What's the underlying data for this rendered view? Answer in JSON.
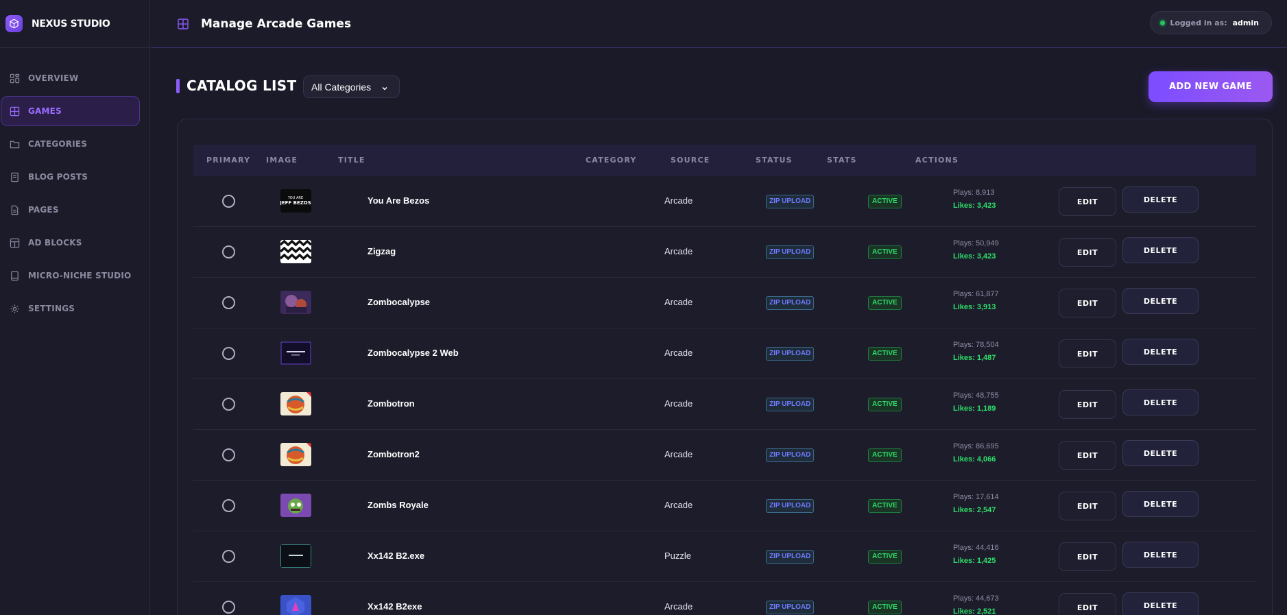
{
  "brand": {
    "name": "NEXUS STUDIO"
  },
  "sidebar": {
    "items": [
      {
        "label": "OVERVIEW",
        "icon": "dashboard-icon"
      },
      {
        "label": "GAMES",
        "icon": "grid-icon",
        "active": true
      },
      {
        "label": "CATEGORIES",
        "icon": "folder-icon"
      },
      {
        "label": "BLOG POSTS",
        "icon": "book-icon"
      },
      {
        "label": "PAGES",
        "icon": "document-icon"
      },
      {
        "label": "AD BLOCKS",
        "icon": "ad-grid-icon"
      },
      {
        "label": "MICRO-NICHE STUDIO",
        "icon": "notebook-icon"
      },
      {
        "label": "SETTINGS",
        "icon": "gear-icon"
      }
    ]
  },
  "header": {
    "title": "Manage Arcade Games",
    "login_label": "Logged in as:",
    "login_user": "admin"
  },
  "toolbar": {
    "catalog_title": "CATALOG LIST",
    "category_filter": "All Categories",
    "add_button": "ADD NEW GAME"
  },
  "table": {
    "headers": [
      "PRIMARY",
      "IMAGE",
      "TITLE",
      "CATEGORY",
      "SOURCE",
      "STATUS",
      "STATS",
      "ACTIONS"
    ],
    "edit_label": "EDIT",
    "delete_label": "DELETE",
    "rows": [
      {
        "title": "You Are Bezos",
        "category": "Arcade",
        "source": "ZIP UPLOAD",
        "status": "ACTIVE",
        "plays": "Plays: 8,913",
        "likes": "Likes: 3,423",
        "thumb": "bezos"
      },
      {
        "title": "Zigzag",
        "category": "Arcade",
        "source": "ZIP UPLOAD",
        "status": "ACTIVE",
        "plays": "Plays: 50,949",
        "likes": "Likes: 3,423",
        "thumb": "zigzag"
      },
      {
        "title": "Zombocalypse",
        "category": "Arcade",
        "source": "ZIP UPLOAD",
        "status": "ACTIVE",
        "plays": "Plays: 61,877",
        "likes": "Likes: 3,913",
        "thumb": "zombo"
      },
      {
        "title": "Zombocalypse 2 Web",
        "category": "Arcade",
        "source": "ZIP UPLOAD",
        "status": "ACTIVE",
        "plays": "Plays: 78,504",
        "likes": "Likes: 1,487",
        "thumb": "zombo2"
      },
      {
        "title": "Zombotron",
        "category": "Arcade",
        "source": "ZIP UPLOAD",
        "status": "ACTIVE",
        "plays": "Plays: 48,755",
        "likes": "Likes: 1,189",
        "thumb": "ball"
      },
      {
        "title": "Zombotron2",
        "category": "Arcade",
        "source": "ZIP UPLOAD",
        "status": "ACTIVE",
        "plays": "Plays: 86,695",
        "likes": "Likes: 4,066",
        "thumb": "ball"
      },
      {
        "title": "Zombs Royale",
        "category": "Arcade",
        "source": "ZIP UPLOAD",
        "status": "ACTIVE",
        "plays": "Plays: 17,614",
        "likes": "Likes: 2,547",
        "thumb": "royale"
      },
      {
        "title": "Xx142 B2.exe",
        "category": "Puzzle",
        "source": "ZIP UPLOAD",
        "status": "ACTIVE",
        "plays": "Plays: 44,416",
        "likes": "Likes: 1,425",
        "thumb": "xx"
      },
      {
        "title": "Xx142 B2exe",
        "category": "Arcade",
        "source": "ZIP UPLOAD",
        "status": "ACTIVE",
        "plays": "Plays: 44,673",
        "likes": "Likes: 2,521",
        "thumb": "hex"
      }
    ]
  },
  "colors": {
    "accent": "#8b5cf6",
    "background": "#1a1a28",
    "active_green": "#2ee06a",
    "source_blue": "#6f7bff"
  }
}
